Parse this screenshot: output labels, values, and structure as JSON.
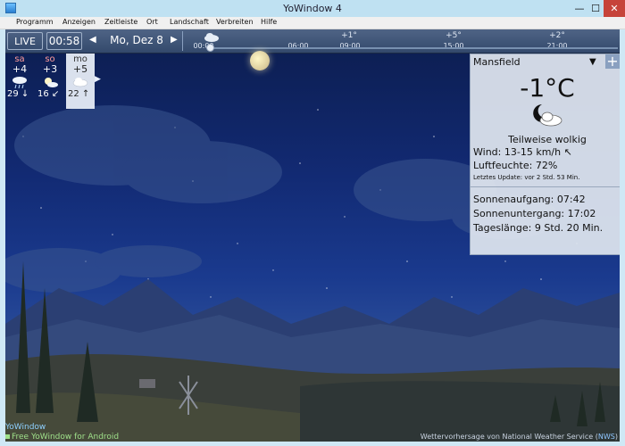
{
  "window": {
    "title": "YoWindow 4",
    "min": "—",
    "max": "☐",
    "close": "✕"
  },
  "menu": [
    "Programm",
    "Anzeigen",
    "Zeitleiste",
    "Ort",
    "Landschaft",
    "Verbreiten",
    "Hilfe"
  ],
  "toolbar": {
    "live": "LIVE",
    "time": "00:58",
    "date": "Mo, Dez 8",
    "prev": "◀",
    "next": "▶"
  },
  "timeline": {
    "temps": [
      "+1°",
      "+5°",
      "+2°"
    ],
    "times": [
      "00:00",
      "06:00",
      "09:00",
      "15:00",
      "21:00"
    ]
  },
  "forecast": [
    {
      "day": "sa",
      "temp": "+4",
      "icon": "rain-cloud-icon",
      "wind": "29 ↓",
      "selected": false
    },
    {
      "day": "so",
      "temp": "+3",
      "icon": "sun-cloud-icon",
      "wind": "16 ↙",
      "selected": false
    },
    {
      "day": "mo",
      "temp": "+5",
      "icon": "cloud-icon",
      "wind": "22 ↑",
      "selected": true
    }
  ],
  "forecast_next": "▶",
  "panel": {
    "city": "Mansfield",
    "dropdown": "▼",
    "add": "+",
    "temp": "-1°C",
    "condition": "Teilweise wolkig",
    "wind_label": "Wind:",
    "wind_value": "13-15 km/h ↖",
    "humidity_label": "Luftfeuchte:",
    "humidity_value": "72%",
    "updated_label": "Letztes Update:",
    "updated_value": "vor 2 Std. 53 Min.",
    "sunrise_label": "Sonnenaufgang:",
    "sunrise_value": "07:42",
    "sunset_label": "Sonnenuntergang:",
    "sunset_value": "17:02",
    "daylength_label": "Tageslänge:",
    "daylength_value": "9 Std. 20 Min."
  },
  "footer": {
    "brand": "YoWindow",
    "android": "Free YoWindow for Android",
    "credit": "Wettervorhersage von National Weather Service (",
    "credit_link": "NWS",
    "credit_end": ")"
  }
}
